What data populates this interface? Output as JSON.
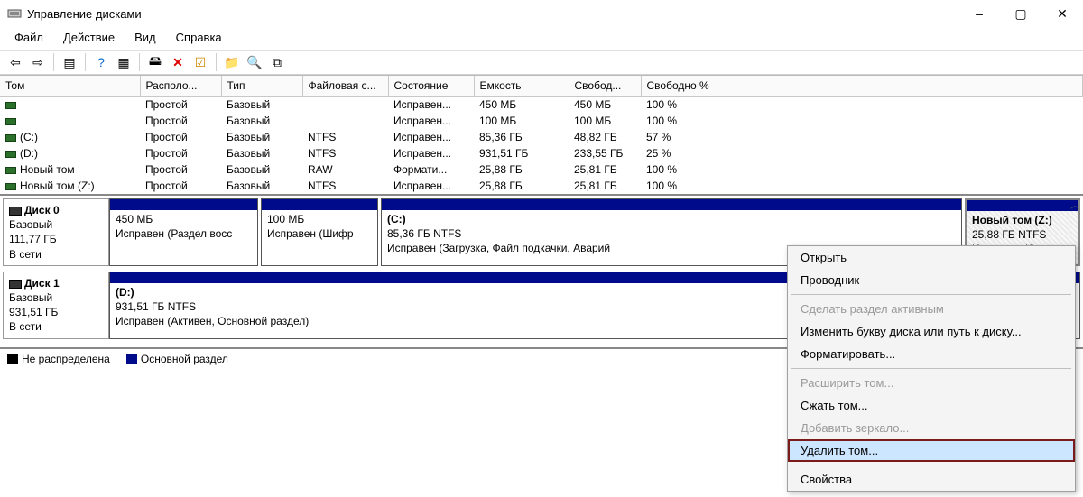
{
  "window": {
    "title": "Управление дисками",
    "minimize": "–",
    "maximize": "▢",
    "close": "✕"
  },
  "menu": {
    "file": "Файл",
    "action": "Действие",
    "view": "Вид",
    "help": "Справка"
  },
  "columns": {
    "c0": "Том",
    "c1": "Располо...",
    "c2": "Тип",
    "c3": "Файловая с...",
    "c4": "Состояние",
    "c5": "Емкость",
    "c6": "Свобод...",
    "c7": "Свободно %"
  },
  "rows": [
    {
      "name": "",
      "layout": "Простой",
      "type": "Базовый",
      "fs": "",
      "state": "Исправен...",
      "cap": "450 МБ",
      "free": "450 МБ",
      "pct": "100 %"
    },
    {
      "name": "",
      "layout": "Простой",
      "type": "Базовый",
      "fs": "",
      "state": "Исправен...",
      "cap": "100 МБ",
      "free": "100 МБ",
      "pct": "100 %"
    },
    {
      "name": "(C:)",
      "layout": "Простой",
      "type": "Базовый",
      "fs": "NTFS",
      "state": "Исправен...",
      "cap": "85,36 ГБ",
      "free": "48,82 ГБ",
      "pct": "57 %"
    },
    {
      "name": "(D:)",
      "layout": "Простой",
      "type": "Базовый",
      "fs": "NTFS",
      "state": "Исправен...",
      "cap": "931,51 ГБ",
      "free": "233,55 ГБ",
      "pct": "25 %"
    },
    {
      "name": "Новый том",
      "layout": "Простой",
      "type": "Базовый",
      "fs": "RAW",
      "state": "Формати...",
      "cap": "25,88 ГБ",
      "free": "25,81 ГБ",
      "pct": "100 %"
    },
    {
      "name": "Новый том (Z:)",
      "layout": "Простой",
      "type": "Базовый",
      "fs": "NTFS",
      "state": "Исправен...",
      "cap": "25,88 ГБ",
      "free": "25,81 ГБ",
      "pct": "100 %"
    }
  ],
  "disk0": {
    "label": "Диск 0",
    "type": "Базовый",
    "size": "111,77 ГБ",
    "status": "В сети",
    "p0": {
      "title": "",
      "line1": "450 МБ",
      "line2": "Исправен (Раздел восс"
    },
    "p1": {
      "title": "",
      "line1": "100 МБ",
      "line2": "Исправен (Шифр"
    },
    "p2": {
      "title": "(C:)",
      "line1": "85,36 ГБ NTFS",
      "line2": "Исправен (Загрузка, Файл подкачки, Аварий"
    },
    "p3": {
      "title": "Новый том  (Z:)",
      "line1": "25,88 ГБ NTFS",
      "line2": "Исправен (Основ"
    }
  },
  "disk1": {
    "label": "Диск 1",
    "type": "Базовый",
    "size": "931,51 ГБ",
    "status": "В сети",
    "p0": {
      "title": "(D:)",
      "line1": "931,51 ГБ NTFS",
      "line2": "Исправен (Активен, Основной раздел)"
    }
  },
  "legend": {
    "unalloc": "Не распределена",
    "primary": "Основной раздел"
  },
  "ctx": {
    "open": "Открыть",
    "explorer": "Проводник",
    "makeactive": "Сделать раздел активным",
    "changeletter": "Изменить букву диска или путь к диску...",
    "format": "Форматировать...",
    "extend": "Расширить том...",
    "shrink": "Сжать том...",
    "mirror": "Добавить зеркало...",
    "delete": "Удалить том...",
    "props": "Свойства"
  }
}
